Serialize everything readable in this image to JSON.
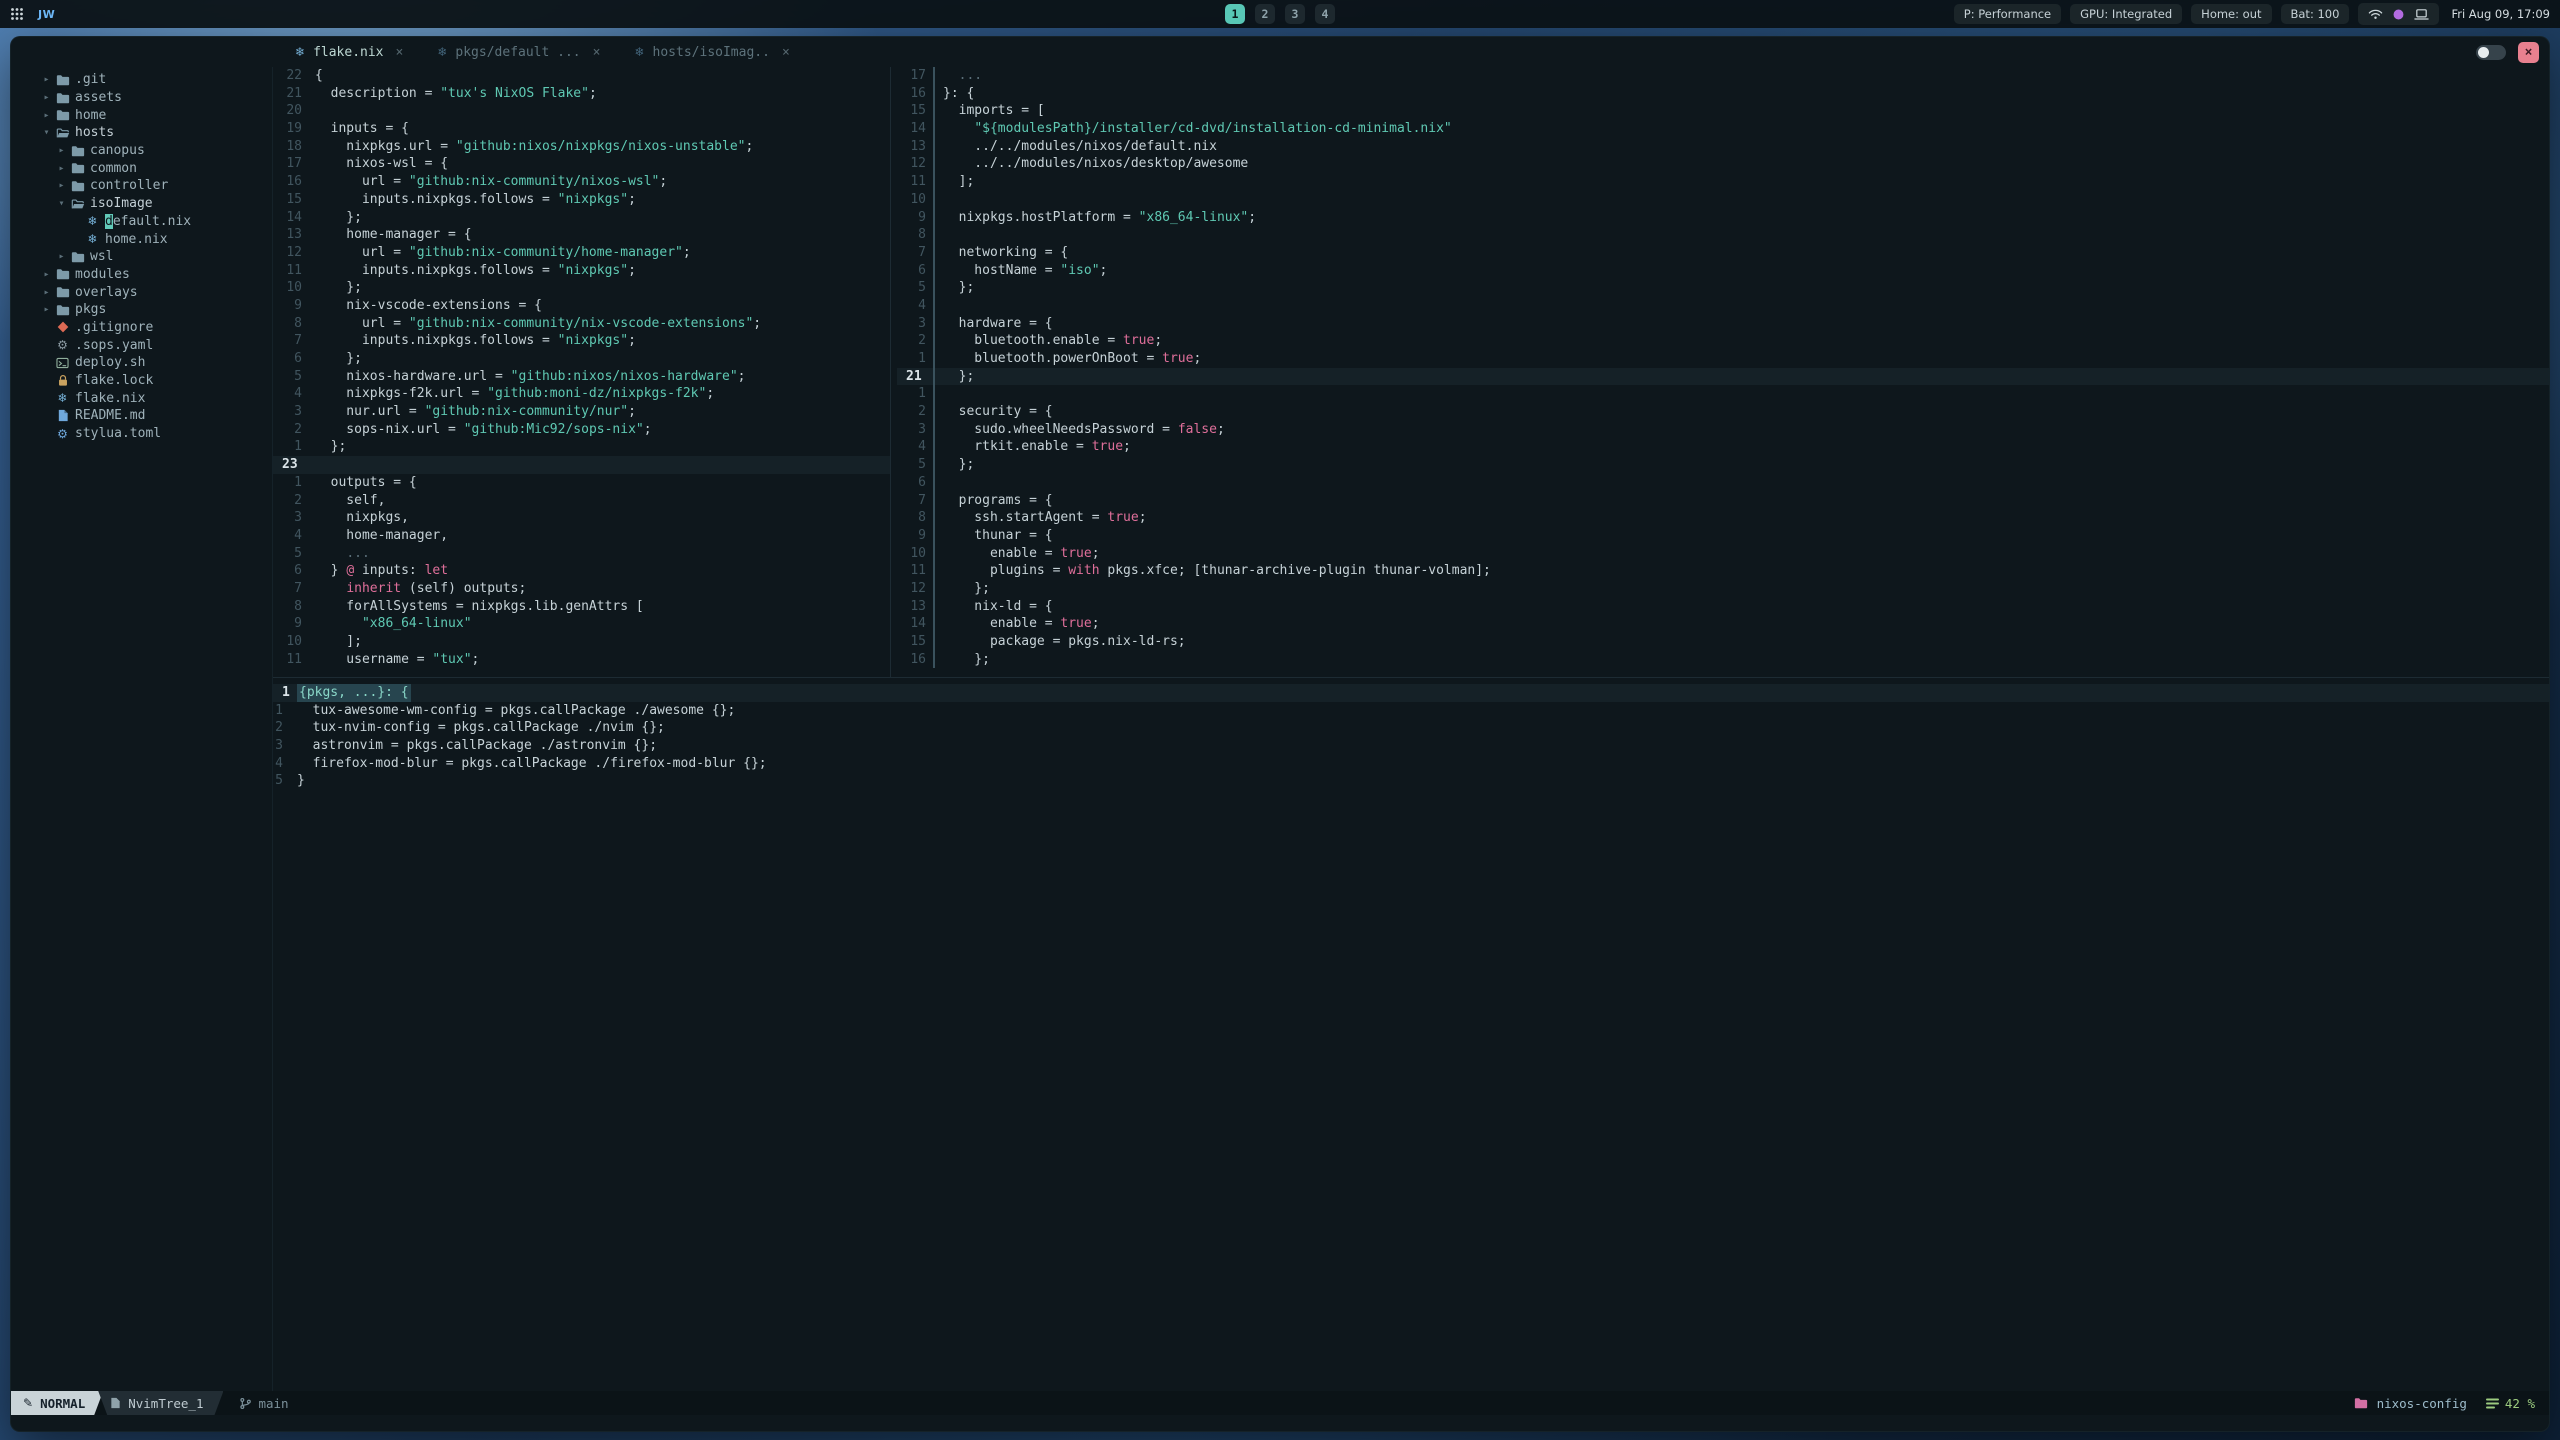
{
  "palette": {
    "accent_teal": "#58c7b6",
    "string_teal": "#5fc9b3",
    "keyword_pink": "#df6f9a",
    "fg": "#c6d2d7",
    "dim": "#5a6e78",
    "bg_window": "#0e171c",
    "bg_statusbar": "#0b1317",
    "close_red": "#e8808f",
    "nix_blue": "#74aed4",
    "git_orange": "#dd6a54",
    "lock_yellow": "#c9a25f",
    "markdown_blue": "#6fa8dc",
    "project_pink": "#d36fa4",
    "scroll_green": "#9ccb7f",
    "tray_dot_purple": "#b26be0"
  },
  "topbar": {
    "logo": "JW",
    "workspaces": [
      "1",
      "2",
      "3",
      "4"
    ],
    "active_workspace": "1",
    "status_chips": [
      "P: Performance",
      "GPU: Integrated",
      "Home: out",
      "Bat: 100"
    ],
    "tray_icons": [
      "wifi",
      "dot",
      "laptop"
    ],
    "clock": "Fri Aug 09, 17:09"
  },
  "titlebar": {
    "tabs": [
      {
        "label": "flake.nix",
        "active": true
      },
      {
        "label": "pkgs/default ...",
        "active": false
      },
      {
        "label": "hosts/isoImag..",
        "active": false
      }
    ],
    "tab_close_glyph": "×",
    "window_close_glyph": "×"
  },
  "tree": {
    "items": [
      {
        "depth": 0,
        "chev": "r",
        "icon": "folder",
        "label": ".git"
      },
      {
        "depth": 0,
        "chev": "r",
        "icon": "folder",
        "label": "assets"
      },
      {
        "depth": 0,
        "chev": "r",
        "icon": "folder",
        "label": "home"
      },
      {
        "depth": 0,
        "chev": "d",
        "icon": "folder-open",
        "label": "hosts",
        "open": true
      },
      {
        "depth": 1,
        "chev": "r",
        "icon": "folder",
        "label": "canopus"
      },
      {
        "depth": 1,
        "chev": "r",
        "icon": "folder",
        "label": "common"
      },
      {
        "depth": 1,
        "chev": "r",
        "icon": "folder",
        "label": "controller"
      },
      {
        "depth": 1,
        "chev": "d",
        "icon": "folder-open",
        "label": "isoImage",
        "open": true
      },
      {
        "depth": 2,
        "icon": "nix",
        "label": "default.nix",
        "cursor": true
      },
      {
        "depth": 2,
        "icon": "nix",
        "label": "home.nix"
      },
      {
        "depth": 1,
        "chev": "r",
        "icon": "folder",
        "label": "wsl"
      },
      {
        "depth": 0,
        "chev": "r",
        "icon": "folder",
        "label": "modules"
      },
      {
        "depth": 0,
        "chev": "r",
        "icon": "folder",
        "label": "overlays"
      },
      {
        "depth": 0,
        "chev": "r",
        "icon": "folder",
        "label": "pkgs"
      },
      {
        "depth": 0,
        "icon": "git",
        "label": ".gitignore"
      },
      {
        "depth": 0,
        "icon": "gear",
        "label": ".sops.yaml"
      },
      {
        "depth": 0,
        "icon": "terminal",
        "label": "deploy.sh"
      },
      {
        "depth": 0,
        "icon": "lock",
        "label": "flake.lock"
      },
      {
        "depth": 0,
        "icon": "nix",
        "label": "flake.nix"
      },
      {
        "depth": 0,
        "icon": "markdown",
        "label": "README.md"
      },
      {
        "depth": 0,
        "icon": "gear-blue",
        "label": "stylua.toml"
      }
    ]
  },
  "editors": {
    "left": {
      "lines": [
        {
          "n": "22",
          "seg": [
            [
              "d",
              "{"
            ]
          ]
        },
        {
          "n": "21",
          "seg": [
            [
              "d",
              "  description = "
            ],
            [
              "s",
              "\"tux's NixOS Flake\""
            ],
            [
              "d",
              ";"
            ]
          ]
        },
        {
          "n": "20",
          "seg": []
        },
        {
          "n": "19",
          "seg": [
            [
              "d",
              "  inputs = {"
            ]
          ]
        },
        {
          "n": "18",
          "seg": [
            [
              "d",
              "    nixpkgs.url = "
            ],
            [
              "s",
              "\"github:nixos/nixpkgs/nixos-unstable\""
            ],
            [
              "d",
              ";"
            ]
          ]
        },
        {
          "n": "17",
          "seg": [
            [
              "d",
              "    nixos-wsl = {"
            ]
          ]
        },
        {
          "n": "16",
          "seg": [
            [
              "d",
              "      url = "
            ],
            [
              "s",
              "\"github:nix-community/nixos-wsl\""
            ],
            [
              "d",
              ";"
            ]
          ]
        },
        {
          "n": "15",
          "seg": [
            [
              "d",
              "      inputs.nixpkgs.follows = "
            ],
            [
              "s",
              "\"nixpkgs\""
            ],
            [
              "d",
              ";"
            ]
          ]
        },
        {
          "n": "14",
          "seg": [
            [
              "d",
              "    };"
            ]
          ]
        },
        {
          "n": "13",
          "seg": [
            [
              "d",
              "    home-manager = {"
            ]
          ]
        },
        {
          "n": "12",
          "seg": [
            [
              "d",
              "      url = "
            ],
            [
              "s",
              "\"github:nix-community/home-manager\""
            ],
            [
              "d",
              ";"
            ]
          ]
        },
        {
          "n": "11",
          "seg": [
            [
              "d",
              "      inputs.nixpkgs.follows = "
            ],
            [
              "s",
              "\"nixpkgs\""
            ],
            [
              "d",
              ";"
            ]
          ]
        },
        {
          "n": "10",
          "seg": [
            [
              "d",
              "    };"
            ]
          ]
        },
        {
          "n": "9",
          "seg": [
            [
              "d",
              "    nix-vscode-extensions = {"
            ]
          ]
        },
        {
          "n": "8",
          "seg": [
            [
              "d",
              "      url = "
            ],
            [
              "s",
              "\"github:nix-community/nix-vscode-extensions\""
            ],
            [
              "d",
              ";"
            ]
          ]
        },
        {
          "n": "7",
          "seg": [
            [
              "d",
              "      inputs.nixpkgs.follows = "
            ],
            [
              "s",
              "\"nixpkgs\""
            ],
            [
              "d",
              ";"
            ]
          ]
        },
        {
          "n": "6",
          "seg": [
            [
              "d",
              "    };"
            ]
          ]
        },
        {
          "n": "5",
          "seg": [
            [
              "d",
              "    nixos-hardware.url = "
            ],
            [
              "s",
              "\"github:nixos/nixos-hardware\""
            ],
            [
              "d",
              ";"
            ]
          ]
        },
        {
          "n": "4",
          "seg": [
            [
              "d",
              "    nixpkgs-f2k.url = "
            ],
            [
              "s",
              "\"github:moni-dz/nixpkgs-f2k\""
            ],
            [
              "d",
              ";"
            ]
          ]
        },
        {
          "n": "3",
          "seg": [
            [
              "d",
              "    nur.url = "
            ],
            [
              "s",
              "\"github:nix-community/nur\""
            ],
            [
              "d",
              ";"
            ]
          ]
        },
        {
          "n": "2",
          "seg": [
            [
              "d",
              "    sops-nix.url = "
            ],
            [
              "s",
              "\"github:Mic92/sops-nix\""
            ],
            [
              "d",
              ";"
            ]
          ]
        },
        {
          "n": "1",
          "seg": [
            [
              "d",
              "  };"
            ]
          ]
        },
        {
          "n": "23",
          "cur": true,
          "seg": []
        },
        {
          "n": "1",
          "seg": [
            [
              "d",
              "  outputs = {"
            ]
          ]
        },
        {
          "n": "2",
          "seg": [
            [
              "d",
              "    self,"
            ]
          ]
        },
        {
          "n": "3",
          "seg": [
            [
              "d",
              "    nixpkgs,"
            ]
          ]
        },
        {
          "n": "4",
          "seg": [
            [
              "d",
              "    home-manager,"
            ]
          ]
        },
        {
          "n": "5",
          "seg": [
            [
              "d",
              "    "
            ],
            [
              "c",
              "..."
            ]
          ]
        },
        {
          "n": "6",
          "seg": [
            [
              "d",
              "  } "
            ],
            [
              "k",
              "@"
            ],
            [
              "d",
              " inputs: "
            ],
            [
              "k",
              "let"
            ]
          ]
        },
        {
          "n": "7",
          "seg": [
            [
              "d",
              "    "
            ],
            [
              "k",
              "inherit"
            ],
            [
              "d",
              " (self) outputs;"
            ]
          ]
        },
        {
          "n": "8",
          "seg": [
            [
              "d",
              "    forAllSystems = nixpkgs.lib.genAttrs ["
            ]
          ]
        },
        {
          "n": "9",
          "seg": [
            [
              "d",
              "      "
            ],
            [
              "s",
              "\"x86_64-linux\""
            ]
          ]
        },
        {
          "n": "10",
          "seg": [
            [
              "d",
              "    ];"
            ]
          ]
        },
        {
          "n": "11",
          "seg": [
            [
              "d",
              "    username = "
            ],
            [
              "s",
              "\"tux\""
            ],
            [
              "d",
              ";"
            ]
          ]
        }
      ]
    },
    "right": {
      "lines": [
        {
          "n": "17",
          "seg": [
            [
              "d",
              "  "
            ],
            [
              "c",
              "..."
            ]
          ]
        },
        {
          "n": "16",
          "seg": [
            [
              "d",
              "}: {"
            ]
          ]
        },
        {
          "n": "15",
          "seg": [
            [
              "d",
              "  imports = ["
            ]
          ]
        },
        {
          "n": "14",
          "seg": [
            [
              "d",
              "    "
            ],
            [
              "s",
              "\"${modulesPath}/installer/cd-dvd/installation-cd-minimal.nix\""
            ]
          ]
        },
        {
          "n": "13",
          "seg": [
            [
              "d",
              "    ../../modules/nixos/default.nix"
            ]
          ]
        },
        {
          "n": "12",
          "seg": [
            [
              "d",
              "    ../../modules/nixos/desktop/awesome"
            ]
          ]
        },
        {
          "n": "11",
          "seg": [
            [
              "d",
              "  ];"
            ]
          ]
        },
        {
          "n": "10",
          "seg": []
        },
        {
          "n": "9",
          "seg": [
            [
              "d",
              "  nixpkgs.hostPlatform = "
            ],
            [
              "s",
              "\"x86_64-linux\""
            ],
            [
              "d",
              ";"
            ]
          ]
        },
        {
          "n": "8",
          "seg": []
        },
        {
          "n": "7",
          "seg": [
            [
              "d",
              "  networking = {"
            ]
          ]
        },
        {
          "n": "6",
          "seg": [
            [
              "d",
              "    hostName = "
            ],
            [
              "s",
              "\"iso\""
            ],
            [
              "d",
              ";"
            ]
          ]
        },
        {
          "n": "5",
          "seg": [
            [
              "d",
              "  };"
            ]
          ]
        },
        {
          "n": "4",
          "seg": []
        },
        {
          "n": "3",
          "seg": [
            [
              "d",
              "  hardware = {"
            ]
          ]
        },
        {
          "n": "2",
          "seg": [
            [
              "d",
              "    bluetooth.enable = "
            ],
            [
              "k",
              "true"
            ],
            [
              "d",
              ";"
            ]
          ]
        },
        {
          "n": "1",
          "seg": [
            [
              "d",
              "    bluetooth.powerOnBoot = "
            ],
            [
              "k",
              "true"
            ],
            [
              "d",
              ";"
            ]
          ]
        },
        {
          "n": "21",
          "cur": true,
          "seg": [
            [
              "d",
              "  };"
            ]
          ]
        },
        {
          "n": "1",
          "seg": []
        },
        {
          "n": "2",
          "seg": [
            [
              "d",
              "  security = {"
            ]
          ]
        },
        {
          "n": "3",
          "seg": [
            [
              "d",
              "    sudo.wheelNeedsPassword = "
            ],
            [
              "k",
              "false"
            ],
            [
              "d",
              ";"
            ]
          ]
        },
        {
          "n": "4",
          "seg": [
            [
              "d",
              "    rtkit.enable = "
            ],
            [
              "k",
              "true"
            ],
            [
              "d",
              ";"
            ]
          ]
        },
        {
          "n": "5",
          "seg": [
            [
              "d",
              "  };"
            ]
          ]
        },
        {
          "n": "6",
          "seg": []
        },
        {
          "n": "7",
          "seg": [
            [
              "d",
              "  programs = {"
            ]
          ]
        },
        {
          "n": "8",
          "seg": [
            [
              "d",
              "    ssh.startAgent = "
            ],
            [
              "k",
              "true"
            ],
            [
              "d",
              ";"
            ]
          ]
        },
        {
          "n": "9",
          "seg": [
            [
              "d",
              "    thunar = {"
            ]
          ]
        },
        {
          "n": "10",
          "seg": [
            [
              "d",
              "      enable = "
            ],
            [
              "k",
              "true"
            ],
            [
              "d",
              ";"
            ]
          ]
        },
        {
          "n": "11",
          "seg": [
            [
              "d",
              "      plugins = "
            ],
            [
              "k",
              "with"
            ],
            [
              "d",
              " pkgs.xfce; [thunar-archive-plugin thunar-volman];"
            ]
          ]
        },
        {
          "n": "12",
          "seg": [
            [
              "d",
              "    };"
            ]
          ]
        },
        {
          "n": "13",
          "seg": [
            [
              "d",
              "    nix-ld = {"
            ]
          ]
        },
        {
          "n": "14",
          "seg": [
            [
              "d",
              "      enable = "
            ],
            [
              "k",
              "true"
            ],
            [
              "d",
              ";"
            ]
          ]
        },
        {
          "n": "15",
          "seg": [
            [
              "d",
              "      package = pkgs.nix-ld-rs;"
            ]
          ]
        },
        {
          "n": "16",
          "seg": [
            [
              "d",
              "    };"
            ]
          ]
        }
      ]
    },
    "bottom": {
      "lines": [
        {
          "n": "1",
          "cur": true,
          "hl": true,
          "seg": [
            [
              "t",
              "{pkgs, ...}: {"
            ]
          ]
        },
        {
          "n": "1",
          "seg": [
            [
              "d",
              "  tux-awesome-wm-config = pkgs.callPackage ./awesome {};"
            ]
          ]
        },
        {
          "n": "2",
          "seg": [
            [
              "d",
              "  tux-nvim-config = pkgs.callPackage ./nvim {};"
            ]
          ]
        },
        {
          "n": "3",
          "seg": [
            [
              "d",
              "  astronvim = pkgs.callPackage ./astronvim {};"
            ]
          ]
        },
        {
          "n": "4",
          "seg": [
            [
              "d",
              "  firefox-mod-blur = pkgs.callPackage ./firefox-mod-blur {};"
            ]
          ]
        },
        {
          "n": "5",
          "seg": [
            [
              "d",
              "}"
            ]
          ]
        }
      ]
    }
  },
  "statusline": {
    "mode": "NORMAL",
    "buffer": "NvimTree_1",
    "branch": "main",
    "project": "nixos-config",
    "scroll": "42 %"
  }
}
